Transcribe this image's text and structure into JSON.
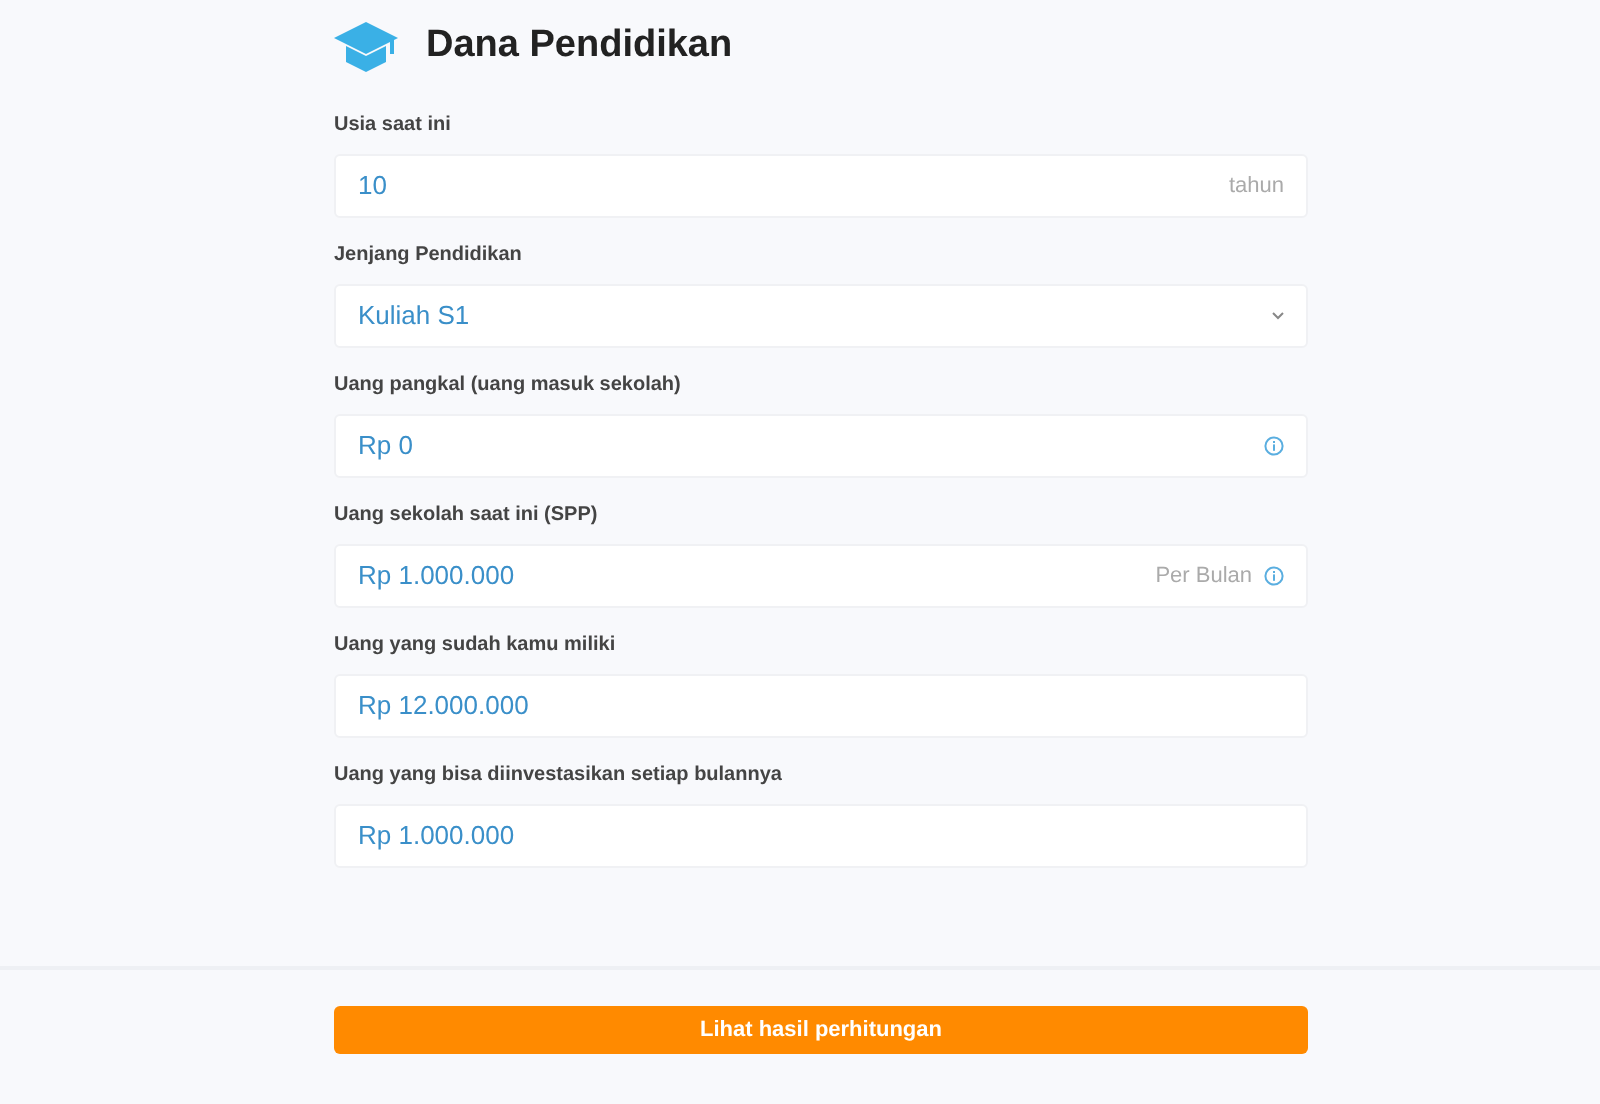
{
  "title": "Dana Pendidikan",
  "fields": [
    {
      "kind": "input",
      "label": "Usia saat ini",
      "value": "10",
      "suffix": "tahun",
      "info": false
    },
    {
      "kind": "select",
      "label": "Jenjang Pendidikan",
      "value": "Kuliah S1",
      "info": false
    },
    {
      "kind": "input",
      "label": "Uang pangkal (uang masuk sekolah)",
      "value": "Rp 0",
      "info": true
    },
    {
      "kind": "input",
      "label": "Uang sekolah saat ini (SPP)",
      "value": "Rp 1.000.000",
      "suffix": "Per Bulan",
      "info": true
    },
    {
      "kind": "input",
      "label": "Uang yang sudah kamu miliki",
      "value": "Rp 12.000.000",
      "info": false
    },
    {
      "kind": "input",
      "label": "Uang yang bisa diinvestasikan setiap bulannya",
      "value": "Rp 1.000.000",
      "info": false
    }
  ],
  "submit_button": "Lihat hasil perhitungan"
}
